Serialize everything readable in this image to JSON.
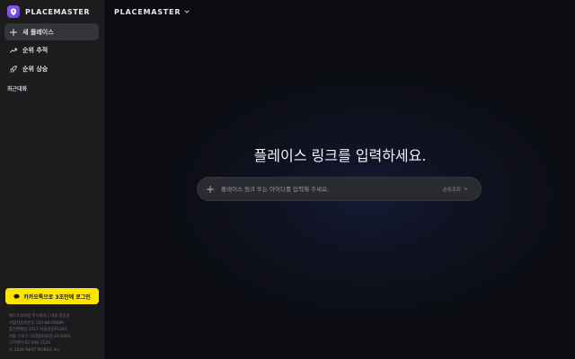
{
  "brand": {
    "name": "PLACEMASTER"
  },
  "sidebar": {
    "items": [
      {
        "label": "새 플레이스",
        "icon": "plus-icon"
      },
      {
        "label": "순위 추적",
        "icon": "trending-up-icon"
      },
      {
        "label": "순위 상승",
        "icon": "rocket-icon"
      }
    ],
    "recent_label": "최근대화",
    "kakao_login_label": "카카오톡으로 3초만에 로그인",
    "footer_lines": [
      "에스트모바일 주식회사 | 대표 김종걸",
      "사업자등록번호 134-88-00689",
      "통신판매업 2017-서울강남01443",
      "서울 구로구 디지털로26길 43 R901",
      "고객센터 02-540-1120",
      "© 2026 NEXT MOBILE Inc."
    ]
  },
  "main": {
    "top_title": "PLACEMASTER",
    "headline": "플레이스 링크를 입력하세요.",
    "search": {
      "placeholder": "플레이스 링크 또는 아이디를 입력해 주세요.",
      "mode_label": "순위조회"
    }
  },
  "colors": {
    "accent": "#7c4dff",
    "kakao": "#fee500",
    "sidebar_bg": "#1c1c1f",
    "active_item_bg": "#34353b"
  }
}
